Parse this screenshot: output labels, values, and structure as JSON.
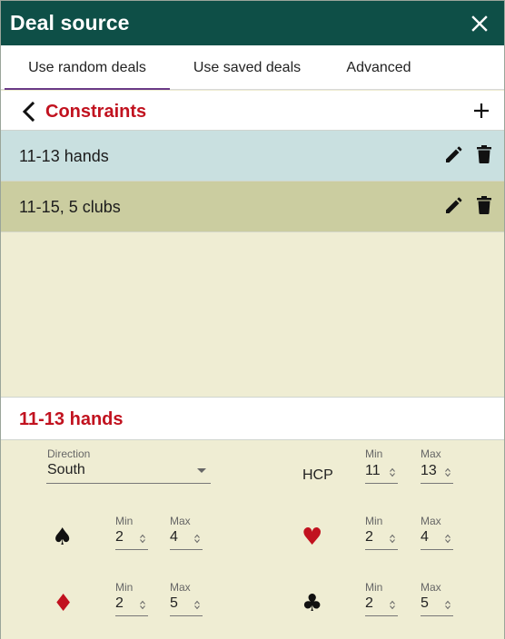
{
  "dialog": {
    "title": "Deal source"
  },
  "tabs": [
    {
      "label": "Use random deals",
      "active": true
    },
    {
      "label": "Use saved deals",
      "active": false
    },
    {
      "label": "Advanced",
      "active": false
    }
  ],
  "constraints": {
    "header": "Constraints",
    "items": [
      {
        "label": "11-13 hands"
      },
      {
        "label": "11-15, 5 clubs"
      }
    ]
  },
  "editor": {
    "title": "11-13 hands",
    "direction": {
      "label": "Direction",
      "value": "South"
    },
    "hcp": {
      "label": "HCP",
      "min_label": "Min",
      "max_label": "Max",
      "min": "11",
      "max": "13"
    },
    "suits": {
      "spades": {
        "symbol": "♠",
        "min_label": "Min",
        "max_label": "Max",
        "min": "2",
        "max": "4"
      },
      "hearts": {
        "symbol": "♥",
        "min_label": "Min",
        "max_label": "Max",
        "min": "2",
        "max": "4"
      },
      "diamonds": {
        "symbol": "♦",
        "min_label": "Min",
        "max_label": "Max",
        "min": "2",
        "max": "5"
      },
      "clubs": {
        "symbol": "♣",
        "min_label": "Min",
        "max_label": "Max",
        "min": "2",
        "max": "5"
      }
    }
  },
  "colors": {
    "titlebar": "#0e4f47",
    "accent_red": "#c1121f",
    "active_tab_underline": "#6a3a87",
    "row_selected": "#c9e0e0",
    "row_alt": "#cbcda0",
    "panel": "#efedd3"
  },
  "icons": {
    "close": "close-icon",
    "back": "chevron-left-icon",
    "add": "plus-icon",
    "edit": "pencil-icon",
    "delete": "trash-icon",
    "dropdown": "caret-down-icon",
    "spinner": "spinner-icon"
  }
}
